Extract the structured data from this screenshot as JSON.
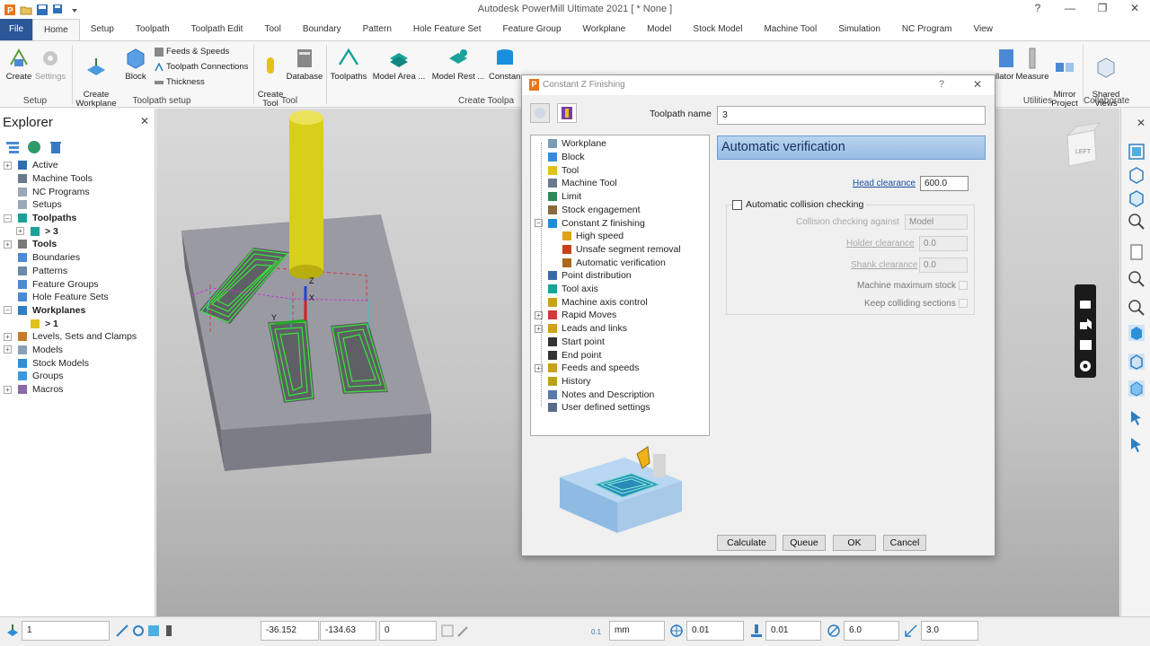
{
  "window": {
    "title": "Autodesk PowerMill Ultimate 2021   [ * None ]",
    "controls": [
      "?",
      "—",
      "❐",
      "✕"
    ]
  },
  "ribbon_tabs": [
    "File",
    "Home",
    "Setup",
    "Toolpath",
    "Toolpath Edit",
    "Tool",
    "Boundary",
    "Pattern",
    "Hole Feature Set",
    "Feature Group",
    "Workplane",
    "Model",
    "Stock Model",
    "Machine Tool",
    "Simulation",
    "NC Program",
    "View"
  ],
  "ribbon": {
    "create": "Create",
    "settings": "Settings",
    "setup_group": "Setup",
    "create_workplane": "Create\nWorkplane",
    "block": "Block",
    "feeds_speeds": "Feeds & Speeds",
    "toolpath_connections": "Toolpath Connections",
    "thickness": "Thickness",
    "toolpath_setup_group": "Toolpath setup",
    "create_tool": "Create\nTool",
    "database": "Database",
    "tool_group": "Tool",
    "toolpaths": "Toolpaths",
    "model_area": "Model Area ...",
    "model_rest": "Model Rest ...",
    "constant": "Constan",
    "create_toolpaths_group": "Create Toolpa",
    "collator": "llator",
    "measure": "Measure",
    "mirror_project": "Mirror\nProject",
    "utilities_group": "Utilities",
    "shared_views": "Shared\nViews",
    "collaborate_group": "Collaborate"
  },
  "explorer": {
    "title": "Explorer",
    "close": "✕",
    "items": [
      {
        "label": "Active",
        "bold": false,
        "expander": "+",
        "indent": 0
      },
      {
        "label": "Machine Tools",
        "bold": false,
        "expander": "",
        "indent": 0
      },
      {
        "label": "NC Programs",
        "bold": false,
        "expander": "",
        "indent": 0
      },
      {
        "label": "Setups",
        "bold": false,
        "expander": "",
        "indent": 0
      },
      {
        "label": "Toolpaths",
        "bold": true,
        "expander": "−",
        "indent": 0
      },
      {
        "label": "> 3",
        "bold": true,
        "expander": "+",
        "indent": 1
      },
      {
        "label": "Tools",
        "bold": true,
        "expander": "+",
        "indent": 0
      },
      {
        "label": "Boundaries",
        "bold": false,
        "expander": "",
        "indent": 0
      },
      {
        "label": "Patterns",
        "bold": false,
        "expander": "",
        "indent": 0
      },
      {
        "label": "Feature Groups",
        "bold": false,
        "expander": "",
        "indent": 0
      },
      {
        "label": "Hole Feature Sets",
        "bold": false,
        "expander": "",
        "indent": 0
      },
      {
        "label": "Workplanes",
        "bold": true,
        "expander": "−",
        "indent": 0
      },
      {
        "label": "> 1",
        "bold": true,
        "expander": "",
        "indent": 1
      },
      {
        "label": "Levels, Sets and Clamps",
        "bold": false,
        "expander": "+",
        "indent": 0
      },
      {
        "label": "Models",
        "bold": false,
        "expander": "+",
        "indent": 0
      },
      {
        "label": "Stock Models",
        "bold": false,
        "expander": "",
        "indent": 0
      },
      {
        "label": "Groups",
        "bold": false,
        "expander": "",
        "indent": 0
      },
      {
        "label": "Macros",
        "bold": false,
        "expander": "+",
        "indent": 0
      }
    ]
  },
  "viewport": {
    "cube_label": "LEFT",
    "axis_z": "Z",
    "axis_y": "Y",
    "axis_x": "X"
  },
  "dialog": {
    "title": "Constant Z Finishing",
    "help": "?",
    "close": "✕",
    "toolpath_name_label": "Toolpath name",
    "toolpath_name_value": "3",
    "tree": [
      {
        "label": "Workplane",
        "level": 0,
        "expander": ""
      },
      {
        "label": "Block",
        "level": 0,
        "expander": ""
      },
      {
        "label": "Tool",
        "level": 0,
        "expander": ""
      },
      {
        "label": "Machine Tool",
        "level": 0,
        "expander": ""
      },
      {
        "label": "Limit",
        "level": 0,
        "expander": ""
      },
      {
        "label": "Stock engagement",
        "level": 0,
        "expander": ""
      },
      {
        "label": "Constant Z finishing",
        "level": 0,
        "expander": "−"
      },
      {
        "label": "High speed",
        "level": 1,
        "expander": ""
      },
      {
        "label": "Unsafe segment removal",
        "level": 1,
        "expander": ""
      },
      {
        "label": "Automatic verification",
        "level": 1,
        "expander": ""
      },
      {
        "label": "Point distribution",
        "level": 0,
        "expander": ""
      },
      {
        "label": "Tool axis",
        "level": 0,
        "expander": ""
      },
      {
        "label": "Machine axis control",
        "level": 0,
        "expander": ""
      },
      {
        "label": "Rapid Moves",
        "level": 0,
        "expander": "+"
      },
      {
        "label": "Leads and links",
        "level": 0,
        "expander": "+"
      },
      {
        "label": "Start point",
        "level": 0,
        "expander": ""
      },
      {
        "label": "End point",
        "level": 0,
        "expander": ""
      },
      {
        "label": "Feeds and speeds",
        "level": 0,
        "expander": "+"
      },
      {
        "label": "History",
        "level": 0,
        "expander": ""
      },
      {
        "label": "Notes and Description",
        "level": 0,
        "expander": ""
      },
      {
        "label": "User defined settings",
        "level": 0,
        "expander": ""
      }
    ],
    "panel_title": "Automatic verification",
    "head_clearance_label": "Head clearance",
    "head_clearance_value": "600.0",
    "auto_collision_label": "Automatic collision checking",
    "collision_against_label": "Collision checking against",
    "collision_against_value": "Model",
    "holder_clearance_label": "Holder clearance",
    "holder_clearance_value": "0.0",
    "shank_clearance_label": "Shank clearance",
    "shank_clearance_value": "0.0",
    "machine_max_stock_label": "Machine maximum stock",
    "keep_colliding_label": "Keep colliding sections",
    "buttons": {
      "calculate": "Calculate",
      "queue": "Queue",
      "ok": "OK",
      "cancel": "Cancel"
    }
  },
  "statusbar": {
    "workplane": "1",
    "x": "-36.152",
    "y": "-134.63",
    "z": "0",
    "units": "mm",
    "tolerance": "0.01",
    "thickness": "0.01",
    "diameter": "6.0",
    "stepdown": "3.0"
  },
  "colors": {
    "accent": "#2b5797",
    "toolpath": "#39e639",
    "tool": "#d9cf1a",
    "panel_header": "#96bde4"
  }
}
